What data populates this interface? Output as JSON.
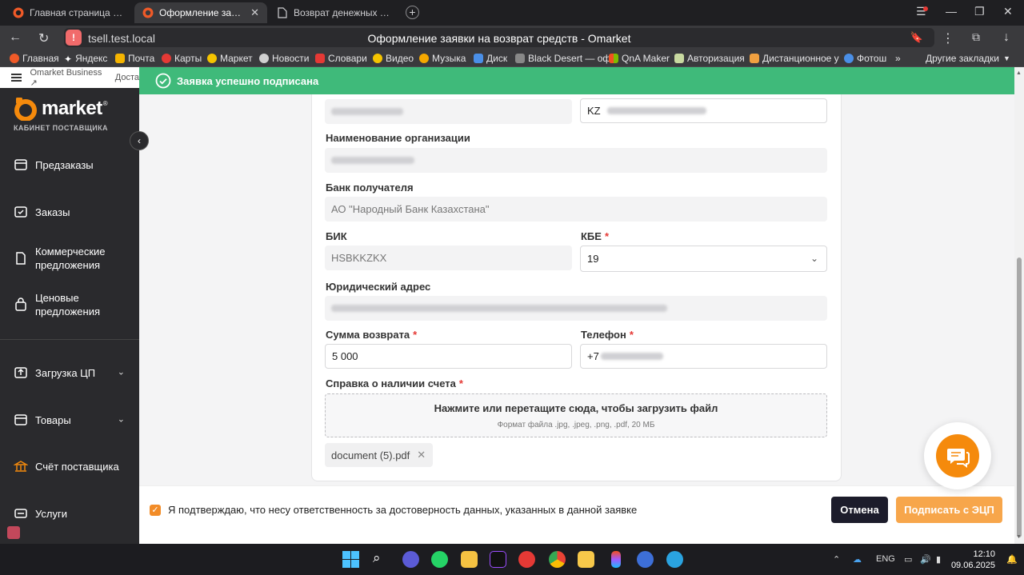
{
  "browser": {
    "tabs": [
      {
        "title": "Главная страница - Omarket",
        "active": false
      },
      {
        "title": "Оформление заявки на возврат средств",
        "active": true
      },
      {
        "title": "Возврат денежных средств",
        "active": false
      }
    ],
    "url": "tsell.test.local",
    "page_title": "Оформление заявки на возврат средств - Omarket",
    "bookmarks": [
      "Главная",
      "Яндекс",
      "Почта",
      "Карты",
      "Маркет",
      "Новости",
      "Словари",
      "Видео",
      "Музыка",
      "Диск",
      "Black Desert — оф",
      "QnA Maker",
      "Авторизация",
      "Дистанционное у",
      "Фотош"
    ],
    "more_bookmarks": "»",
    "other_bookmarks": "Другие закладки"
  },
  "sidebar": {
    "top_link": "Omarket Business",
    "top_link_2": "Доста",
    "logo_text": "market",
    "logo_subtitle": "КАБИНЕТ ПОСТАВЩИКА",
    "items": [
      {
        "label": "Предзаказы",
        "icon": "box-icon"
      },
      {
        "label": "Заказы",
        "icon": "orders-icon"
      },
      {
        "label": "Коммерческие предложения",
        "icon": "document-icon"
      },
      {
        "label": "Ценовые предложения",
        "icon": "bag-icon"
      },
      {
        "label": "Загрузка ЦП",
        "icon": "upload-icon"
      },
      {
        "label": "Товары",
        "icon": "box-icon"
      },
      {
        "label": "Счёт поставщика",
        "icon": "bank-icon"
      },
      {
        "label": "Услуги",
        "icon": "services-icon"
      }
    ]
  },
  "toast": {
    "text": "Заявка успешно подписана"
  },
  "form": {
    "iban_prefix": "KZ",
    "org_name_label": "Наименование организации",
    "bank_label": "Банк получателя",
    "bank_value": "АО \"Народный Банк Казахстана\"",
    "bik_label": "БИК",
    "bik_value": "HSBKKZKX",
    "kbe_label": "КБЕ",
    "kbe_value": "19",
    "legal_address_label": "Юридический адрес",
    "amount_label": "Сумма возврата",
    "amount_value": "5 000",
    "phone_label": "Телефон",
    "phone_prefix": "+7",
    "required_mark": "*",
    "certificate_label": "Справка о наличии счета",
    "upload_main": "Нажмите или перетащите сюда, чтобы загрузить файл",
    "upload_hint": "Формат файла .jpg, .jpeg, .png, .pdf, 20 МБ",
    "file_name": "document (5).pdf"
  },
  "footer": {
    "confirm_text": "Я подтверждаю, что несу ответственность за достоверность данных, указанных в данной заявке",
    "cancel_label": "Отмена",
    "sign_label": "Подписать с ЭЦП"
  },
  "taskbar": {
    "language": "ENG",
    "time": "12:10",
    "date": "09.06.2025"
  },
  "colors": {
    "accent": "#f58a0c",
    "success": "#3fba7a",
    "sidebar": "#2a2a2d",
    "button_dark": "#1c1c2b",
    "required": "#e53935"
  }
}
